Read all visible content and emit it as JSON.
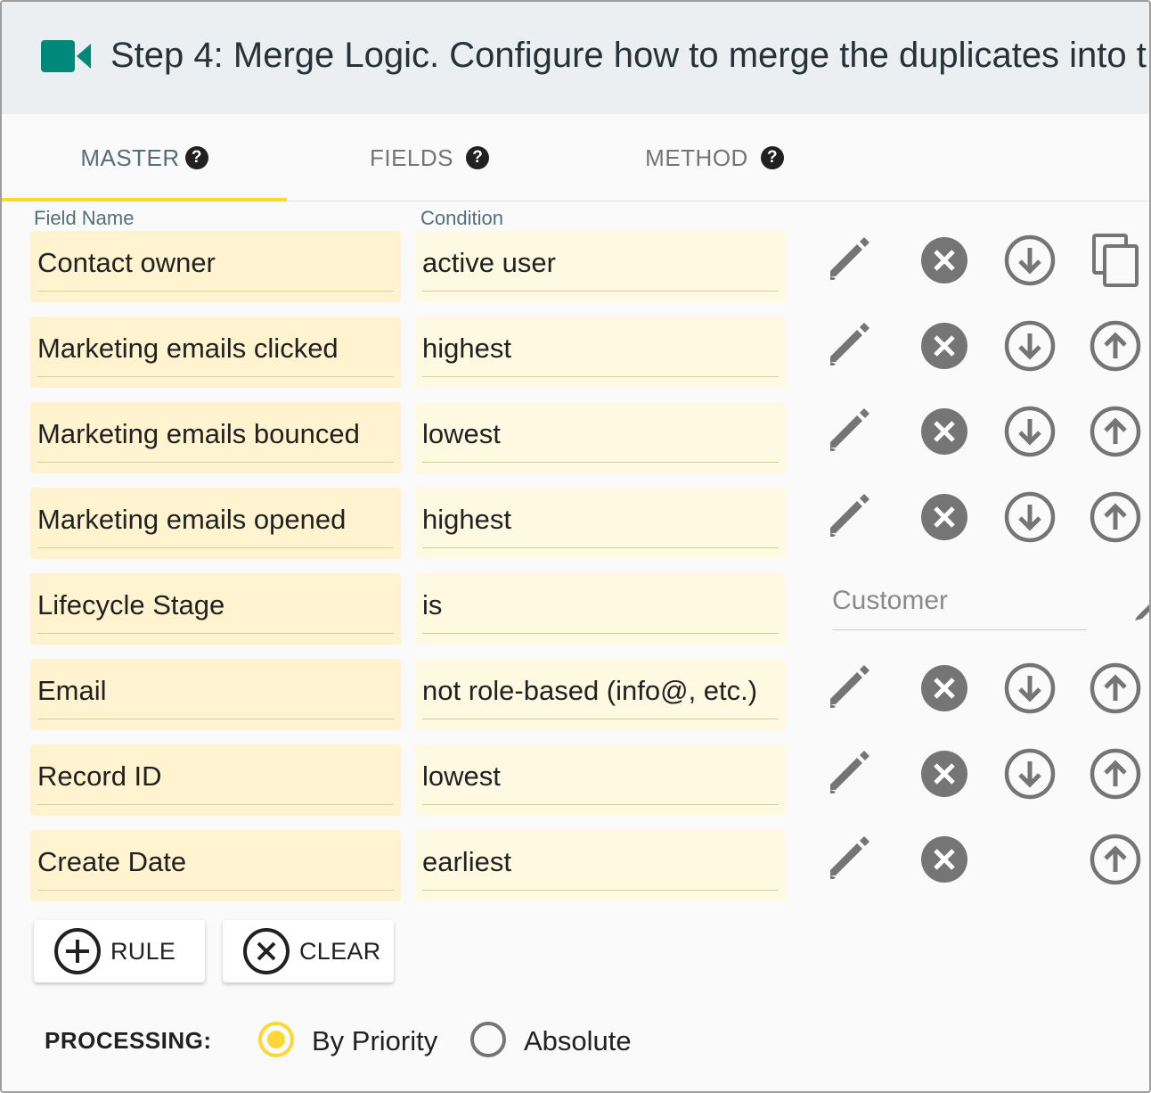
{
  "header": {
    "icon": "video-camera-icon",
    "accent_color": "#00897b",
    "title": "Step 4: Merge Logic. Configure how to merge the duplicates into t"
  },
  "tabs": [
    {
      "label": "MASTER",
      "help": "?",
      "active": true
    },
    {
      "label": "FIELDS",
      "help": "?",
      "active": false
    },
    {
      "label": "METHOD",
      "help": "?",
      "active": false
    }
  ],
  "columns": {
    "field_name": "Field Name",
    "condition": "Condition"
  },
  "rules": [
    {
      "field": "Contact owner",
      "condition": "active user"
    },
    {
      "field": "Marketing emails clicked",
      "condition": "highest"
    },
    {
      "field": "Marketing emails bounced",
      "condition": "lowest"
    },
    {
      "field": "Marketing emails opened",
      "condition": "highest"
    },
    {
      "field": "Lifecycle Stage",
      "condition": "is",
      "value": "Customer"
    },
    {
      "field": "Email",
      "condition": "not role-based (info@, etc.)"
    },
    {
      "field": "Record ID",
      "condition": "lowest"
    },
    {
      "field": "Create Date",
      "condition": "earliest"
    }
  ],
  "buttons": {
    "add_rule": "RULE",
    "clear": "CLEAR"
  },
  "processing": {
    "label": "PROCESSING:",
    "options": [
      {
        "label": "By Priority",
        "selected": true
      },
      {
        "label": "Absolute",
        "selected": false
      }
    ]
  },
  "colors": {
    "field_bg": "#fff4cf",
    "condition_bg": "#fff9e1",
    "tab_indicator": "#fdd835",
    "icon_gray": "#757575",
    "radio_selected": "#fdd835"
  }
}
